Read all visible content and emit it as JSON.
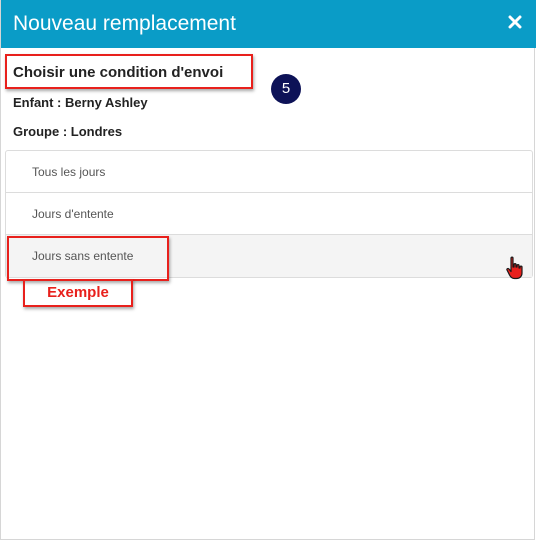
{
  "header": {
    "title": "Nouveau remplacement",
    "close_icon": "close-icon",
    "background_color": "#0a9cc7"
  },
  "section": {
    "title": "Choisir une condition d'envoi"
  },
  "step_badge": "5",
  "info": {
    "child": "Enfant : Berny Ashley",
    "group": "Groupe : Londres"
  },
  "options": [
    {
      "label": "Tous les jours"
    },
    {
      "label": "Jours d'entente"
    },
    {
      "label": "Jours sans entente"
    }
  ],
  "annotation": {
    "example_label": "Exemple",
    "accent_color": "#e8201c"
  },
  "cursor_icon": "hand-pointer-icon"
}
